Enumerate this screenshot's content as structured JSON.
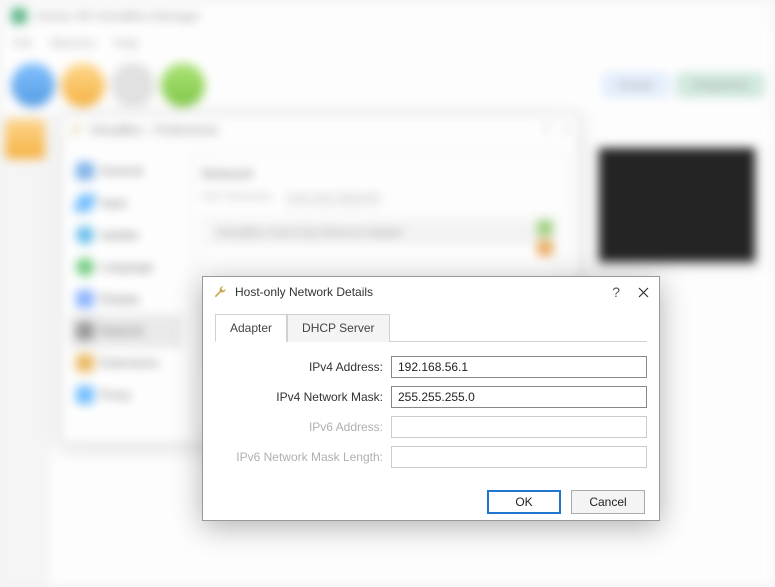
{
  "mainWindow": {
    "title": "Oracle VM VirtualBox Manager",
    "menu": [
      "File",
      "Machine",
      "Help"
    ],
    "rightButtons": [
      "Details",
      "Snapshots"
    ]
  },
  "prefs": {
    "title": "VirtualBox - Preferences",
    "sidebar": [
      "General",
      "Input",
      "Update",
      "Language",
      "Display",
      "Network",
      "Extensions",
      "Proxy"
    ],
    "selectedSidebar": "Network",
    "heading": "Network",
    "tabs": [
      "NAT Networks",
      "Host-only Networks"
    ],
    "activeTab": "Host-only Networks",
    "adapterRow": "VirtualBox Host-Only Ethernet Adapter"
  },
  "detail": {
    "title": "Host-only Network Details",
    "tabs": {
      "adapter": "Adapter",
      "dhcp": "DHCP Server"
    },
    "fields": {
      "ipv4_addr_label": "IPv4 Address:",
      "ipv4_addr_value": "192.168.56.1",
      "ipv4_mask_label": "IPv4 Network Mask:",
      "ipv4_mask_value": "255.255.255.0",
      "ipv6_addr_label": "IPv6 Address:",
      "ipv6_addr_value": "",
      "ipv6_len_label": "IPv6 Network Mask Length:",
      "ipv6_len_value": ""
    },
    "buttons": {
      "ok": "OK",
      "cancel": "Cancel"
    }
  }
}
